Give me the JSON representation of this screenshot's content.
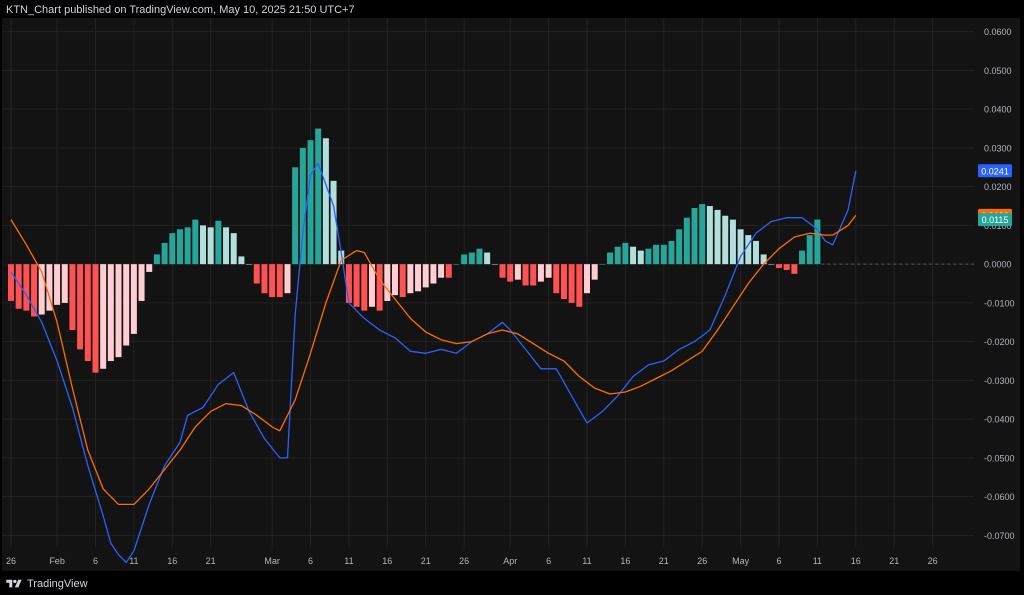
{
  "header": {
    "text": "KTN_Chart published on TradingView.com, May 10, 2025 21:50 UTC+7"
  },
  "footer": {
    "brand": "TradingView",
    "logo_icon": "tradingview-logo-icon"
  },
  "colors": {
    "background": "#131313",
    "grid": "#232323",
    "text": "#b2b5be",
    "macd_line": "#2962ff",
    "signal_line": "#ff6d00",
    "hist_pos_rising": "#26a69a",
    "hist_pos_falling": "#b2dfdb",
    "hist_neg_falling": "#ff5252",
    "hist_neg_rising": "#ffcdd2",
    "zero_line": "#555555"
  },
  "chart_data": {
    "type": "bar",
    "indicator": "MACD histogram with MACD and signal lines",
    "ylim": [
      -0.073,
      0.0625
    ],
    "y_ticks": [
      "0.0600",
      "0.0500",
      "0.0400",
      "0.0300",
      "0.0200",
      "0.0100",
      "0.0000",
      "-0.0100",
      "-0.0200",
      "-0.0300",
      "-0.0400",
      "-0.0500",
      "-0.0600",
      "-0.0700"
    ],
    "y_tick_values": [
      0.06,
      0.05,
      0.04,
      0.03,
      0.02,
      0.01,
      0,
      -0.01,
      -0.02,
      -0.03,
      -0.04,
      -0.05,
      -0.06,
      -0.07
    ],
    "x_ticks": [
      {
        "label": "26",
        "day": 0
      },
      {
        "label": "Feb",
        "day": 6
      },
      {
        "label": "6",
        "day": 11
      },
      {
        "label": "11",
        "day": 16
      },
      {
        "label": "16",
        "day": 21
      },
      {
        "label": "21",
        "day": 26
      },
      {
        "label": "Mar",
        "day": 34
      },
      {
        "label": "6",
        "day": 39
      },
      {
        "label": "11",
        "day": 44
      },
      {
        "label": "16",
        "day": 49
      },
      {
        "label": "21",
        "day": 54
      },
      {
        "label": "26",
        "day": 59
      },
      {
        "label": "Apr",
        "day": 65
      },
      {
        "label": "6",
        "day": 70
      },
      {
        "label": "11",
        "day": 75
      },
      {
        "label": "16",
        "day": 80
      },
      {
        "label": "21",
        "day": 85
      },
      {
        "label": "26",
        "day": 90
      },
      {
        "label": "May",
        "day": 95
      },
      {
        "label": "6",
        "day": 100
      },
      {
        "label": "11",
        "day": 105
      },
      {
        "label": "16",
        "day": 110
      },
      {
        "label": "21",
        "day": 115
      },
      {
        "label": "26",
        "day": 120
      }
    ],
    "histogram": {
      "start_day": 0,
      "values": [
        -0.0095,
        -0.0115,
        -0.012,
        -0.0135,
        -0.013,
        -0.012,
        -0.0105,
        -0.01,
        -0.017,
        -0.022,
        -0.025,
        -0.028,
        -0.027,
        -0.025,
        -0.024,
        -0.021,
        -0.018,
        -0.0095,
        -0.002,
        0.0025,
        0.0055,
        0.008,
        0.009,
        0.0095,
        0.0115,
        0.01,
        0.0095,
        0.0112,
        0.0095,
        0.008,
        0.002,
        0,
        -0.005,
        -0.0075,
        -0.0085,
        -0.0085,
        -0.0075,
        0.025,
        0.03,
        0.032,
        0.035,
        0.0325,
        0.0215,
        0.0035,
        -0.01,
        -0.011,
        -0.012,
        -0.011,
        -0.012,
        -0.0095,
        -0.008,
        -0.0085,
        -0.0075,
        -0.007,
        -0.006,
        -0.005,
        -0.0035,
        -0.0035,
        0,
        0.0025,
        0.003,
        0.004,
        0.003,
        0,
        -0.0035,
        -0.0045,
        -0.004,
        -0.0055,
        -0.0055,
        -0.0045,
        -0.0035,
        -0.0075,
        -0.009,
        -0.01,
        -0.011,
        -0.0075,
        -0.004,
        0,
        0.003,
        0.0045,
        0.0055,
        0.0045,
        0.0035,
        0.004,
        0.005,
        0.005,
        0.006,
        0.009,
        0.012,
        0.0145,
        0.0155,
        0.015,
        0.014,
        0.0125,
        0.0115,
        0.009,
        0.0075,
        0.006,
        0.0025,
        0,
        -0.001,
        -0.0015,
        -0.0025,
        0.0035,
        0.0075,
        0.0115
      ]
    },
    "series": [
      {
        "key": "macd",
        "points": [
          [
            0,
            -0.002
          ],
          [
            2,
            -0.008
          ],
          [
            4,
            -0.015
          ],
          [
            6,
            -0.025
          ],
          [
            8,
            -0.037
          ],
          [
            10,
            -0.052
          ],
          [
            12,
            -0.065
          ],
          [
            13,
            -0.072
          ],
          [
            14,
            -0.075
          ],
          [
            15,
            -0.077
          ],
          [
            16,
            -0.074
          ],
          [
            18,
            -0.062
          ],
          [
            20,
            -0.052
          ],
          [
            22,
            -0.046
          ],
          [
            23,
            -0.039
          ],
          [
            25,
            -0.037
          ],
          [
            27,
            -0.031
          ],
          [
            29,
            -0.028
          ],
          [
            31,
            -0.038
          ],
          [
            33,
            -0.045
          ],
          [
            35,
            -0.05
          ],
          [
            36,
            -0.05
          ],
          [
            37,
            -0.013
          ],
          [
            38,
            0.008
          ],
          [
            39,
            0.023
          ],
          [
            40,
            0.026
          ],
          [
            42,
            0.015
          ],
          [
            43,
            0.003
          ],
          [
            44,
            -0.01
          ],
          [
            46,
            -0.014
          ],
          [
            48,
            -0.017
          ],
          [
            50,
            -0.019
          ],
          [
            52,
            -0.0225
          ],
          [
            54,
            -0.023
          ],
          [
            56,
            -0.022
          ],
          [
            58,
            -0.023
          ],
          [
            60,
            -0.02
          ],
          [
            62,
            -0.018
          ],
          [
            64,
            -0.015
          ],
          [
            65,
            -0.017
          ],
          [
            67,
            -0.022
          ],
          [
            69,
            -0.027
          ],
          [
            71,
            -0.027
          ],
          [
            73,
            -0.034
          ],
          [
            75,
            -0.041
          ],
          [
            77,
            -0.038
          ],
          [
            79,
            -0.034
          ],
          [
            81,
            -0.029
          ],
          [
            83,
            -0.026
          ],
          [
            85,
            -0.025
          ],
          [
            87,
            -0.022
          ],
          [
            89,
            -0.02
          ],
          [
            91,
            -0.017
          ],
          [
            93,
            -0.008
          ],
          [
            95,
            0.002
          ],
          [
            97,
            0.008
          ],
          [
            99,
            0.011
          ],
          [
            101,
            0.012
          ],
          [
            103,
            0.012
          ],
          [
            105,
            0.009
          ],
          [
            106,
            0.006
          ],
          [
            107,
            0.005
          ],
          [
            109,
            0.014
          ],
          [
            110,
            0.0241
          ]
        ]
      },
      {
        "key": "signal",
        "points": [
          [
            0,
            0.0115
          ],
          [
            2,
            0.005
          ],
          [
            4,
            -0.002
          ],
          [
            6,
            -0.015
          ],
          [
            8,
            -0.032
          ],
          [
            10,
            -0.048
          ],
          [
            12,
            -0.058
          ],
          [
            14,
            -0.062
          ],
          [
            16,
            -0.062
          ],
          [
            18,
            -0.058
          ],
          [
            20,
            -0.053
          ],
          [
            22,
            -0.048
          ],
          [
            24,
            -0.042
          ],
          [
            26,
            -0.038
          ],
          [
            28,
            -0.036
          ],
          [
            30,
            -0.0365
          ],
          [
            32,
            -0.039
          ],
          [
            34,
            -0.042
          ],
          [
            35,
            -0.043
          ],
          [
            37,
            -0.035
          ],
          [
            39,
            -0.023
          ],
          [
            41,
            -0.01
          ],
          [
            43,
            0.001
          ],
          [
            45,
            0.0035
          ],
          [
            46,
            0.003
          ],
          [
            48,
            -0.004
          ],
          [
            50,
            -0.009
          ],
          [
            52,
            -0.014
          ],
          [
            54,
            -0.0175
          ],
          [
            56,
            -0.0195
          ],
          [
            58,
            -0.0205
          ],
          [
            60,
            -0.02
          ],
          [
            62,
            -0.018
          ],
          [
            64,
            -0.017
          ],
          [
            66,
            -0.018
          ],
          [
            68,
            -0.0205
          ],
          [
            70,
            -0.023
          ],
          [
            72,
            -0.025
          ],
          [
            74,
            -0.029
          ],
          [
            76,
            -0.032
          ],
          [
            78,
            -0.0335
          ],
          [
            80,
            -0.033
          ],
          [
            82,
            -0.0315
          ],
          [
            84,
            -0.0295
          ],
          [
            86,
            -0.0275
          ],
          [
            88,
            -0.025
          ],
          [
            90,
            -0.0225
          ],
          [
            92,
            -0.017
          ],
          [
            94,
            -0.011
          ],
          [
            96,
            -0.005
          ],
          [
            98,
            0.0
          ],
          [
            100,
            0.004
          ],
          [
            102,
            0.007
          ],
          [
            104,
            0.008
          ],
          [
            106,
            0.0075
          ],
          [
            107,
            0.0075
          ],
          [
            109,
            0.01
          ],
          [
            110,
            0.0126
          ]
        ]
      }
    ],
    "price_labels": [
      {
        "text": "0.0241",
        "value": 0.0241,
        "color": "#2962ff"
      },
      {
        "text": "0.0126",
        "value": 0.0126,
        "color": "#ff6d00"
      },
      {
        "text": "0.0115",
        "value": 0.0115,
        "color": "#26a69a"
      }
    ],
    "zero_line_style": "dashed"
  }
}
